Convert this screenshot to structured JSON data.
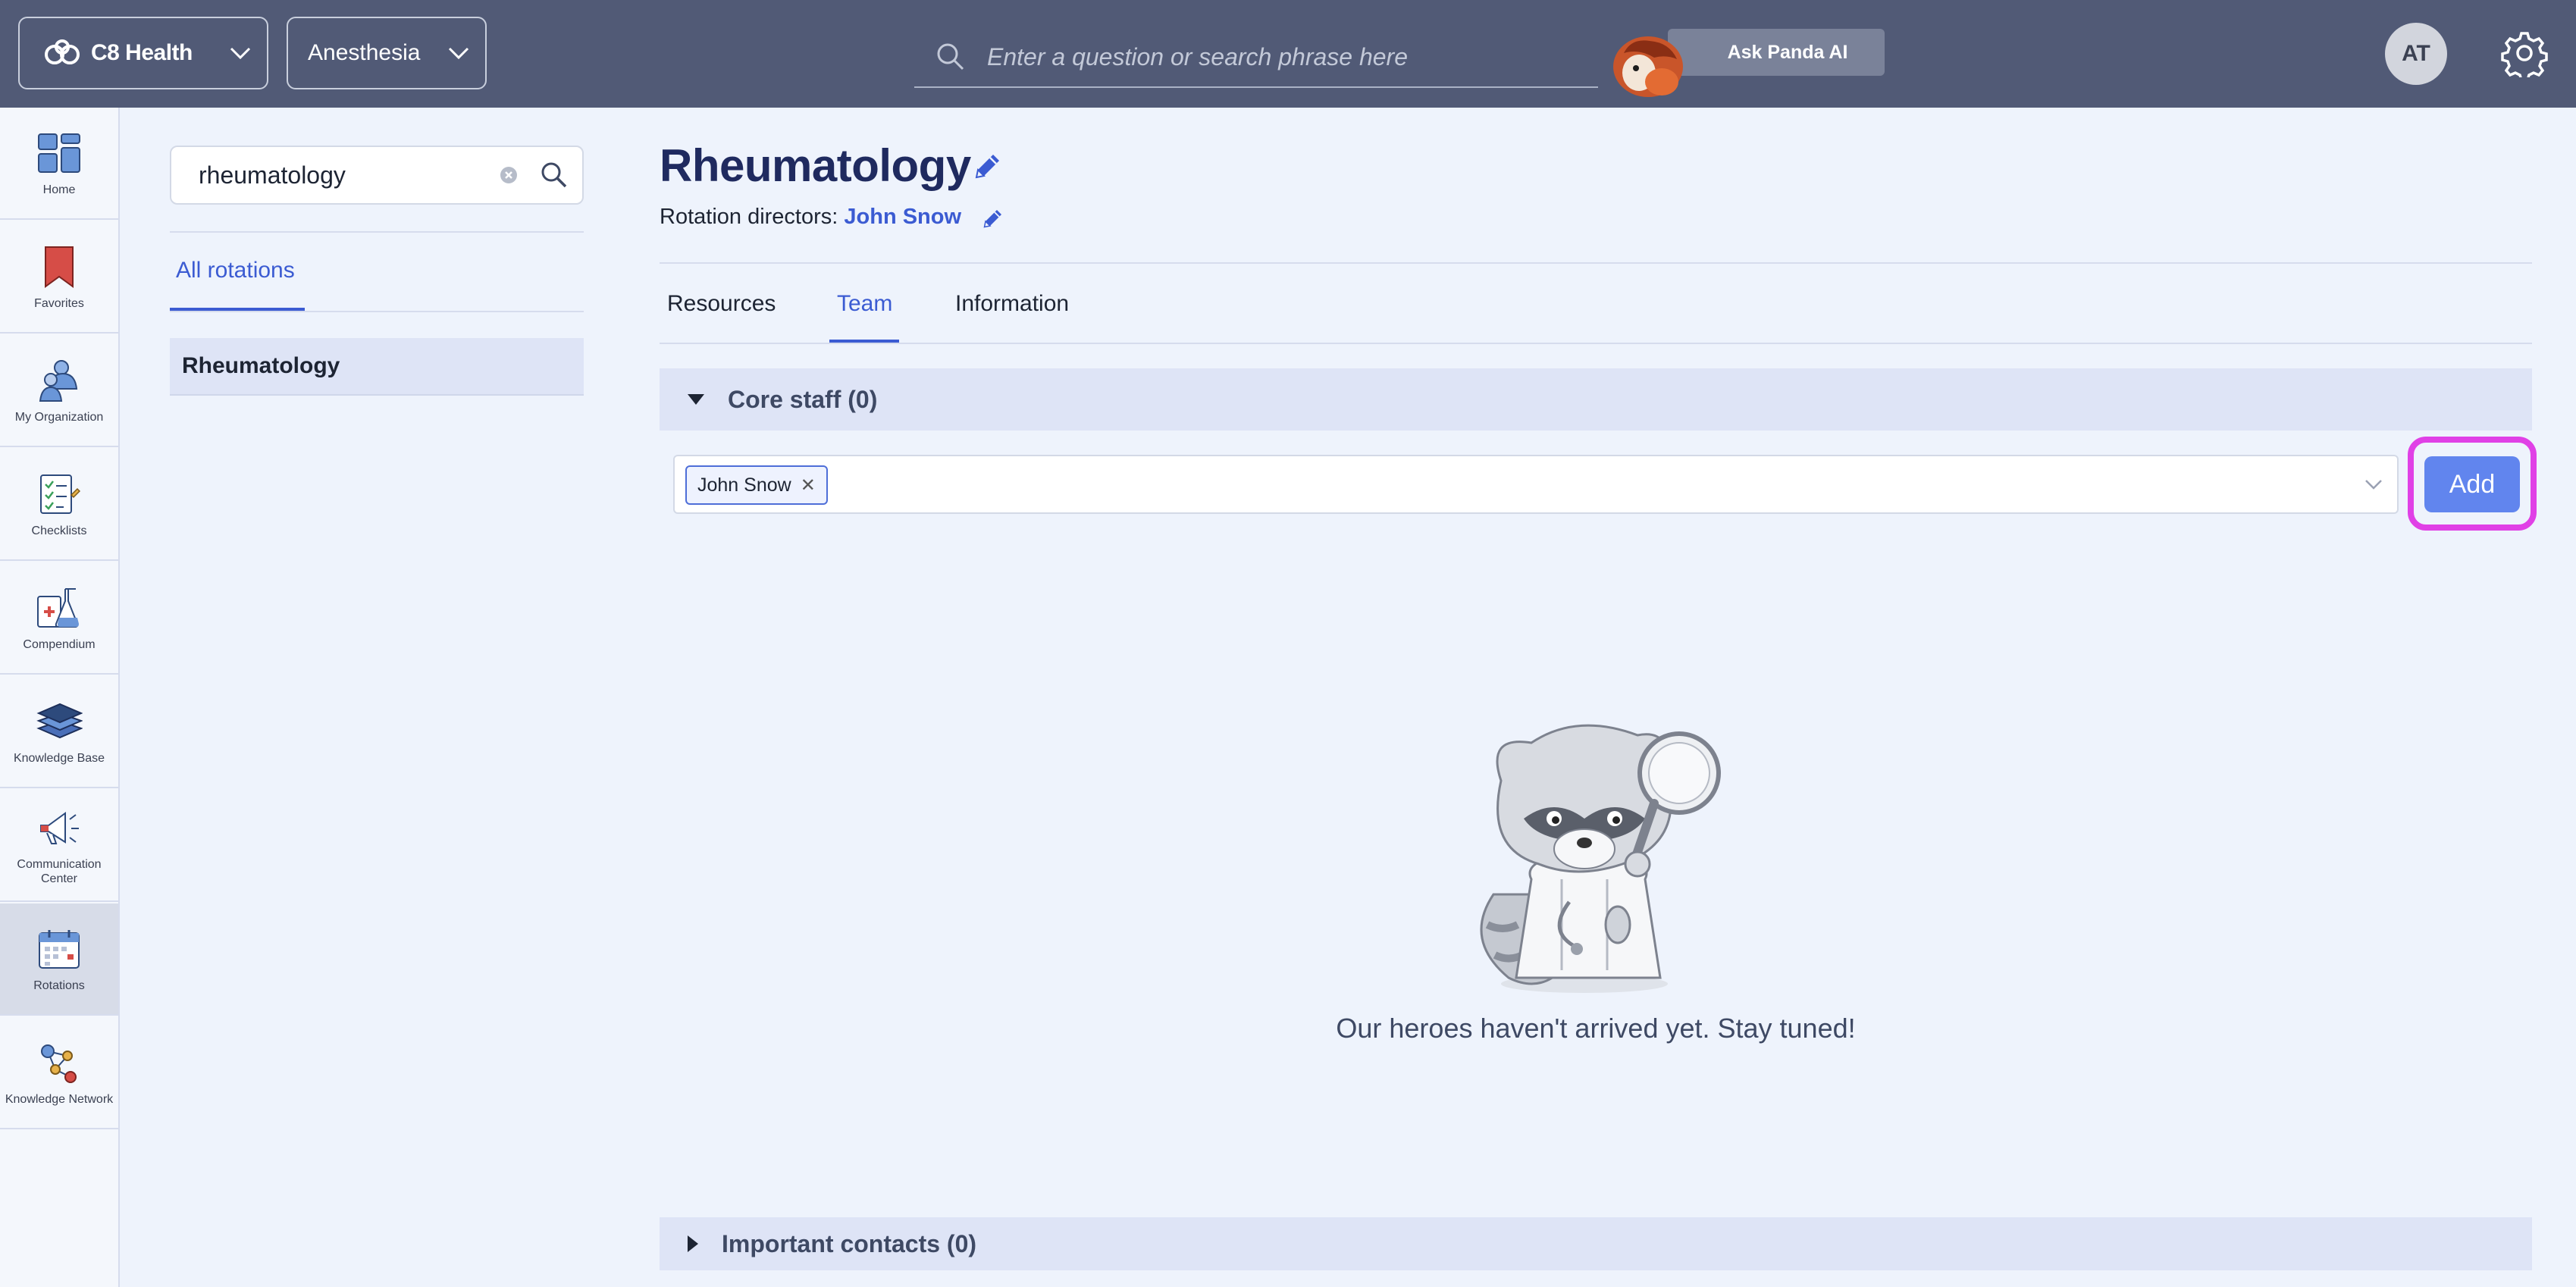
{
  "topbar": {
    "org_name": "C8 Health",
    "department": "Anesthesia",
    "search_placeholder": "Enter a question or search phrase here",
    "ask_label": "Ask Panda AI",
    "avatar_initials": "AT"
  },
  "nav": {
    "items": [
      {
        "label": "Home",
        "icon": "home-icon"
      },
      {
        "label": "Favorites",
        "icon": "bookmark-icon"
      },
      {
        "label": "My Organization",
        "icon": "people-icon"
      },
      {
        "label": "Checklists",
        "icon": "checklist-icon"
      },
      {
        "label": "Compendium",
        "icon": "flask-icon"
      },
      {
        "label": "Knowledge Base",
        "icon": "books-icon"
      },
      {
        "label": "Communication Center",
        "icon": "megaphone-icon"
      },
      {
        "label": "Rotations",
        "icon": "calendar-icon"
      },
      {
        "label": "Knowledge Network",
        "icon": "network-icon"
      }
    ],
    "active": "Rotations"
  },
  "rotations_panel": {
    "search_value": "rheumatology",
    "tab_label": "All rotations",
    "items": [
      "Rheumatology"
    ]
  },
  "main": {
    "title": "Rheumatology",
    "directors_label": "Rotation directors:",
    "directors_name": "John Snow",
    "tabs": [
      "Resources",
      "Team",
      "Information"
    ],
    "active_tab": "Team",
    "core_staff_label": "Core staff (0)",
    "selected_tag": "John Snow",
    "add_label": "Add",
    "empty_message": "Our heroes haven't arrived yet. Stay tuned!",
    "important_contacts_label": "Important contacts (0)"
  },
  "colors": {
    "topbar": "#515a76",
    "accent": "#3b5bd2",
    "add_button": "#6185ee",
    "highlight_ring": "#e040e6"
  }
}
